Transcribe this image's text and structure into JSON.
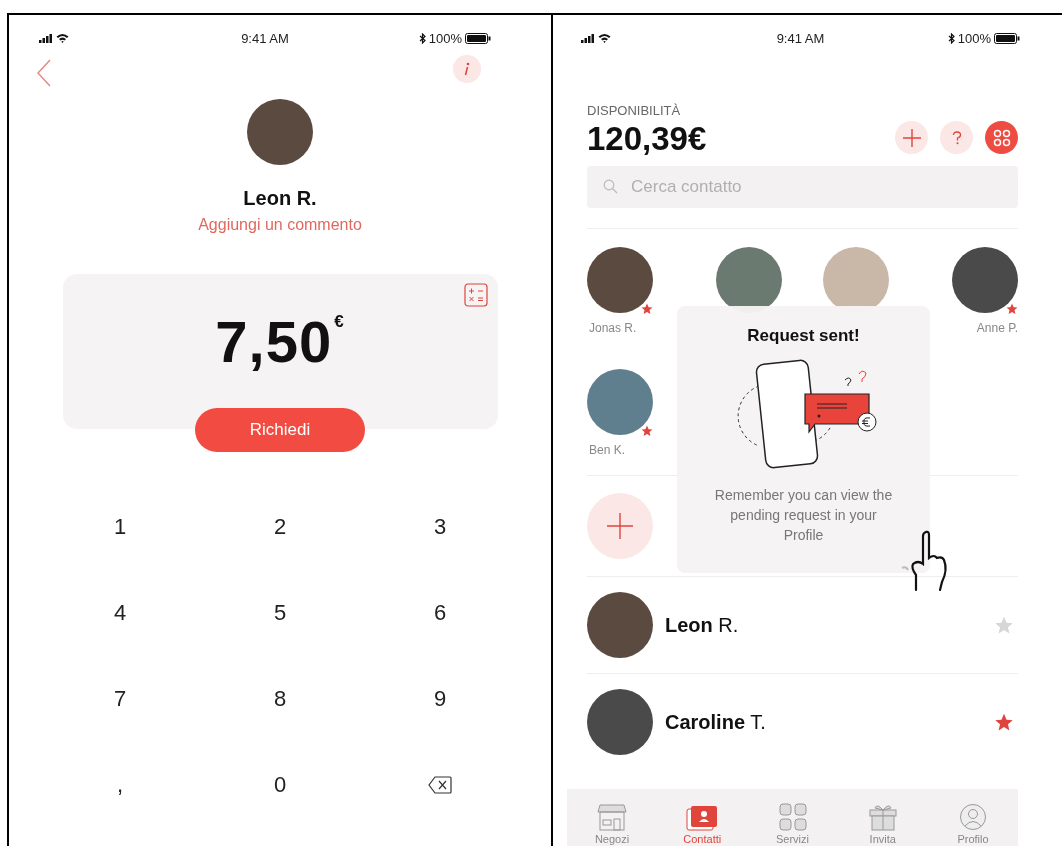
{
  "left_screen": {
    "status_bar": {
      "time": "9:41 AM",
      "battery": "100%"
    },
    "contact": {
      "name": "Leon R.",
      "comment_link": "Aggiungi un commento"
    },
    "amount": {
      "value": "7,50",
      "currency": "€"
    },
    "request_button": "Richiedi",
    "keypad": [
      {
        "kind": "digit",
        "label": "1"
      },
      {
        "kind": "digit",
        "label": "2"
      },
      {
        "kind": "digit",
        "label": "3"
      },
      {
        "kind": "digit",
        "label": "4"
      },
      {
        "kind": "digit",
        "label": "5"
      },
      {
        "kind": "digit",
        "label": "6"
      },
      {
        "kind": "digit",
        "label": "7"
      },
      {
        "kind": "digit",
        "label": "8"
      },
      {
        "kind": "digit",
        "label": "9"
      },
      {
        "kind": "digit",
        "label": ","
      },
      {
        "kind": "digit",
        "label": "0"
      },
      {
        "kind": "backspace"
      }
    ]
  },
  "right_screen": {
    "status_bar": {
      "time": "9:41 AM",
      "battery": "100%"
    },
    "balance_label": "DISPONIBILITÀ",
    "balance": "120,39€",
    "search": {
      "placeholder": "Cerca contatto"
    },
    "favorites": [
      {
        "name": "Jonas R.",
        "starred": true
      },
      {
        "starred": false
      },
      {
        "starred": false
      },
      {
        "name": "Anne P.",
        "starred": true
      },
      {
        "name": "Ben K.",
        "starred": true
      }
    ],
    "contacts": [
      {
        "name": "**Leon** R.",
        "starred": false
      },
      {
        "name": "**Caroline** T.",
        "starred": true
      }
    ],
    "popup": {
      "title": "Request sent!",
      "message": "Remember you can view the pending request in your Profile"
    },
    "tabs": [
      {
        "label": "Negozi",
        "kind": "shop",
        "selected": false
      },
      {
        "label": "Contatti",
        "kind": "contacts",
        "selected": true
      },
      {
        "label": "Servizi",
        "kind": "services",
        "selected": false
      },
      {
        "label": "Invita",
        "kind": "invite",
        "selected": false
      },
      {
        "label": "Profilo",
        "kind": "profile",
        "selected": false
      }
    ]
  }
}
